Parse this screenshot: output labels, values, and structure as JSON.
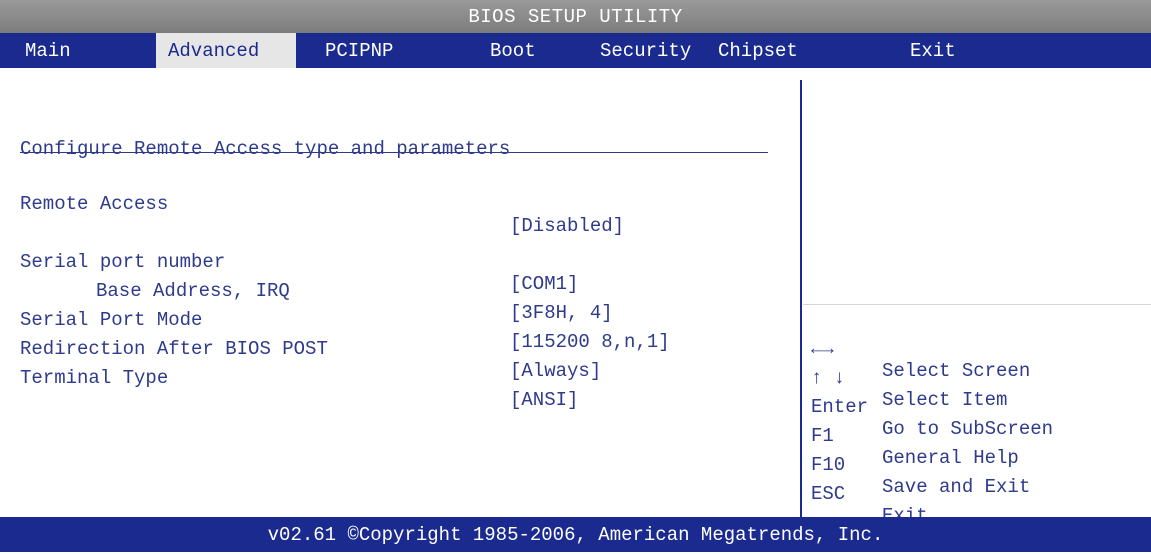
{
  "title": "BIOS SETUP UTILITY",
  "tabs": [
    "Main",
    "Advanced",
    "PCIPNP",
    "Boot",
    "Security",
    "Chipset",
    "Exit"
  ],
  "active_tab": "Advanced",
  "description": "Configure Remote Access type and parameters",
  "settings": [
    {
      "label": "Remote Access",
      "value": "[Disabled]"
    },
    {
      "label": "Serial port number",
      "value": "[COM1]"
    },
    {
      "label": "Base Address, IRQ",
      "value": "[3F8H, 4]"
    },
    {
      "label": "Serial Port Mode",
      "value": "[115200 8,n,1]"
    },
    {
      "label": "Redirection After BIOS POST",
      "value": "[Always]"
    },
    {
      "label": "Terminal Type",
      "value": "[ANSI]"
    }
  ],
  "help": [
    {
      "key": "←→",
      "action": "Select Screen"
    },
    {
      "key": "↑ ↓",
      "action": "Select Item"
    },
    {
      "key": "Enter",
      "action": "Go to SubScreen"
    },
    {
      "key": "F1",
      "action": "General Help"
    },
    {
      "key": "F10",
      "action": "Save and Exit"
    },
    {
      "key": "ESC",
      "action": "Exit"
    }
  ],
  "footer": "v02.61 ©Copyright 1985-2006, American Megatrends, Inc.",
  "colors": {
    "tab_bar": "#1a2a8f",
    "text": "#2e3a8c",
    "title_bar": "#8a8a8a",
    "active_tab_bg": "#e6e6e6"
  }
}
